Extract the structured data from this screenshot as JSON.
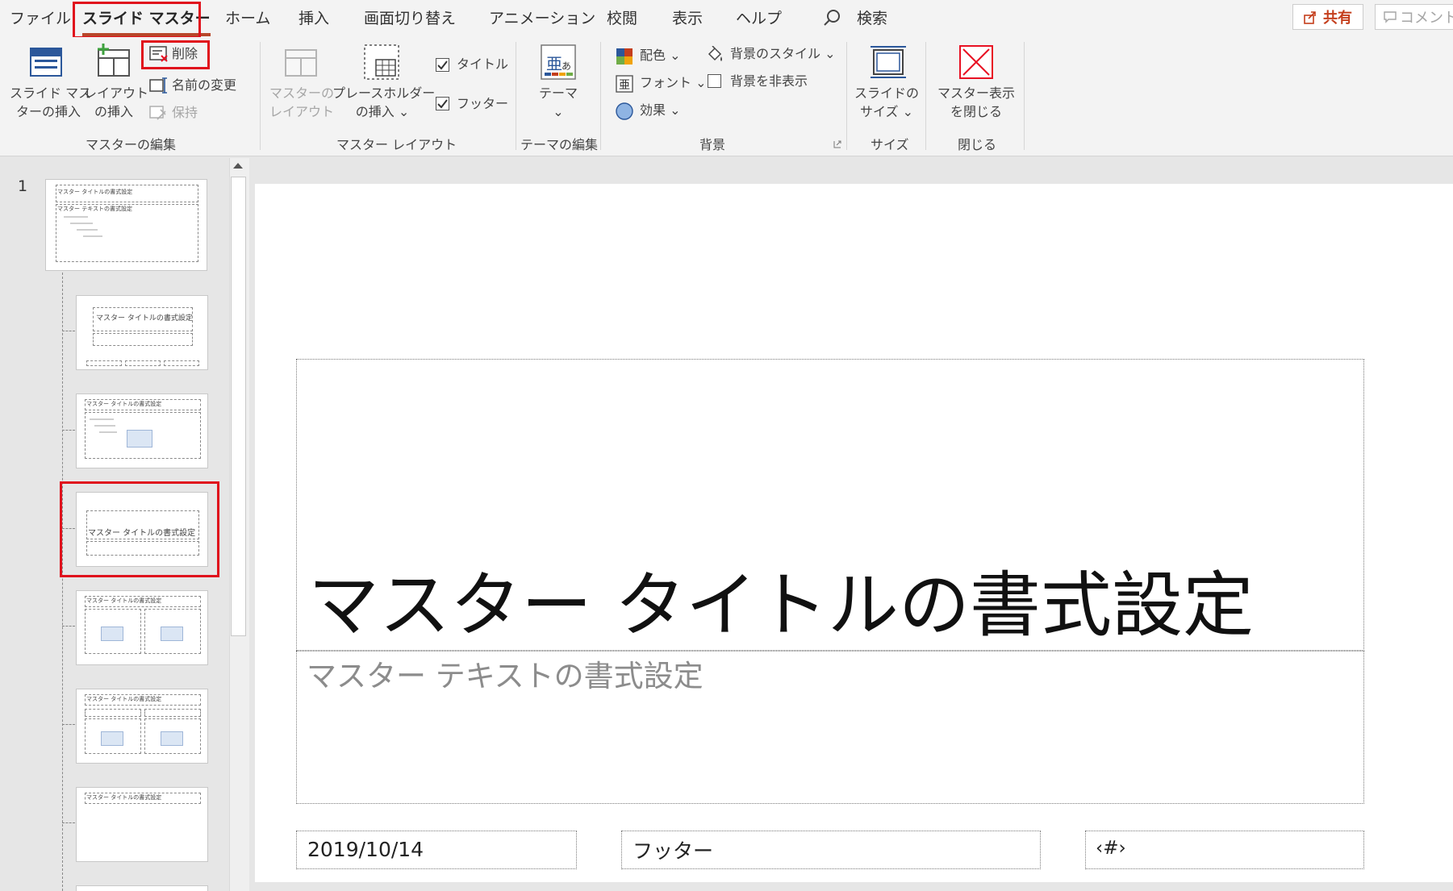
{
  "tabs": [
    "ファイル",
    "スライド マスター",
    "ホーム",
    "挿入",
    "画面切り替え",
    "アニメーション",
    "校閲",
    "表示",
    "ヘルプ",
    "検索"
  ],
  "share_label": "共有",
  "comment_label": "コメント",
  "ribbon": {
    "insert_master": [
      "スライド マス",
      "ターの挿入"
    ],
    "insert_layout": [
      "レイアウト",
      "の挿入"
    ],
    "delete": "削除",
    "rename": "名前の変更",
    "preserve": "保持",
    "master_layout": [
      "マスターの",
      "レイアウト"
    ],
    "insert_placeholder": [
      "プレースホルダー",
      "の挿入 ⌄"
    ],
    "title_check": "タイトル",
    "footer_check": "フッター",
    "theme": [
      "テーマ",
      "⌄"
    ],
    "colors": "配色 ⌄",
    "fonts": "フォント ⌄",
    "effects": "効果 ⌄",
    "bg_styles": "背景のスタイル ⌄",
    "hide_bg": "背景を非表示",
    "slide_size": [
      "スライドの",
      "サイズ ⌄"
    ],
    "close_master": [
      "マスター表示",
      "を閉じる"
    ],
    "groups": {
      "edit_master": "マスターの編集",
      "master_layout": "マスター レイアウト",
      "edit_theme": "テーマの編集",
      "background": "背景",
      "size": "サイズ",
      "close": "閉じる"
    }
  },
  "thumbnails": {
    "master_number": "1",
    "title_text": "マスター タイトルの書式設定",
    "text_text": "マスター テキストの書式設定"
  },
  "slide": {
    "title": "マスター タイトルの書式設定",
    "subtitle": "マスター テキストの書式設定",
    "date": "2019/10/14",
    "footer": "フッター",
    "page_number": "‹#›"
  },
  "colors": {
    "accent": "#b7472a",
    "highlight_box": "#e0101c",
    "close_icon": "#e81123"
  }
}
